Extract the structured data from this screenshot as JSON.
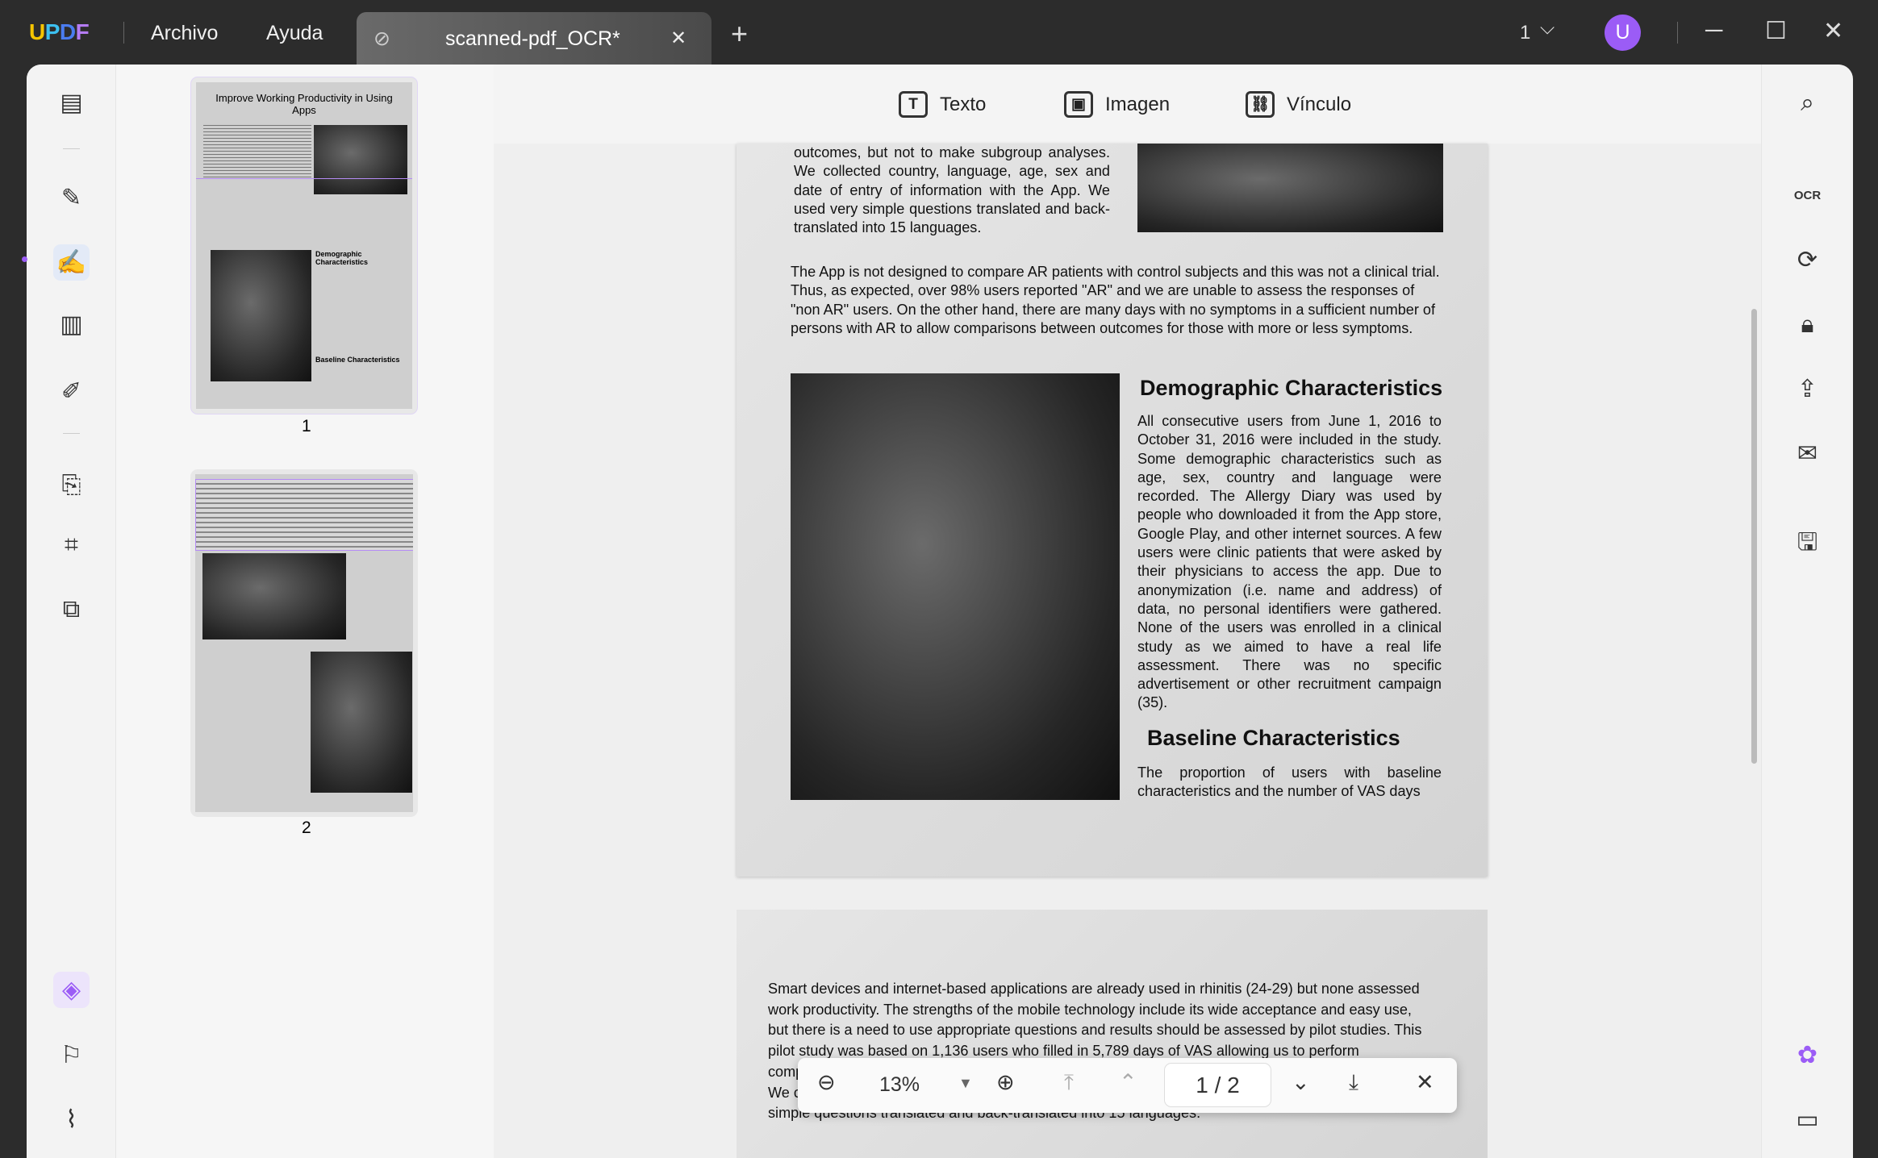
{
  "app": {
    "logo": "UPDF",
    "menu": [
      "Archivo",
      "Ayuda"
    ],
    "tab_title": "scanned-pdf_OCR*",
    "tab_close": "✕",
    "new_tab": "+",
    "account_count": "1",
    "avatar_letter": "U",
    "accent": "#9b5cf6"
  },
  "toolbar": {
    "items": [
      {
        "label": "Texto",
        "icon": "T"
      },
      {
        "label": "Imagen",
        "icon": "▣"
      },
      {
        "label": "Vínculo",
        "icon": "⛓"
      }
    ]
  },
  "thumbnails": [
    {
      "number": "1",
      "title": "Improve Working Productivity in Using Apps",
      "h1": "Demographic Characteristics",
      "h2": "Baseline Characteristics"
    },
    {
      "number": "2"
    }
  ],
  "page1": {
    "para_top": "outcomes, but not to make subgroup analyses. We collected country, language, age, sex and date of entry of information with the App. We used very simple questions translated and back-translated into 15 languages.",
    "para2": "The App is not designed to compare AR patients with control subjects and this was not a clinical trial. Thus, as expected, over 98% users reported \"AR\" and we are unable to assess the responses of \"non AR\" users. On the other hand, there are many days with no symptoms in a sufficient number of persons with AR to allow comparisons between outcomes for those with more or less symptoms.",
    "heading1": "Demographic Characteristics",
    "demo_text": "All consecutive users from June 1, 2016 to October 31, 2016 were included in the study. Some demographic characteristics such as age, sex, country and language were recorded. The Allergy Diary was used by people who downloaded it from the App store, Google Play, and other internet sources. A few users were clinic patients that were asked by their physicians to access the app. Due to anonymization (i.e. name and address) of data, no personal identifiers were gathered. None of the users was enrolled in a clinical study as we aimed to have a real life assessment. There was no specific advertisement or other recruitment campaign (35).",
    "heading2": "Baseline Characteristics",
    "baseline_text": "The proportion of users with baseline characteristics and the number of VAS days"
  },
  "page2": {
    "lines": [
      "Smart devices and internet-based applications are already      used in rhinitis (24-29) but none assessed",
      "work productivity. The strengths of the mobile technology include its wide acceptance and easy use,",
      "but there is a need to use appropriate questions and results should be assessed by pilot studies. This",
      "pilot study was based on 1,136 users who filled in 5,789 days of VAS allowing us to perform",
      "comp",
      "We c",
      "simple questions translated and back-translated into 15 languages."
    ]
  },
  "nav": {
    "zoom": "13%",
    "page_current": "1",
    "page_sep": "/",
    "page_total": "2"
  }
}
